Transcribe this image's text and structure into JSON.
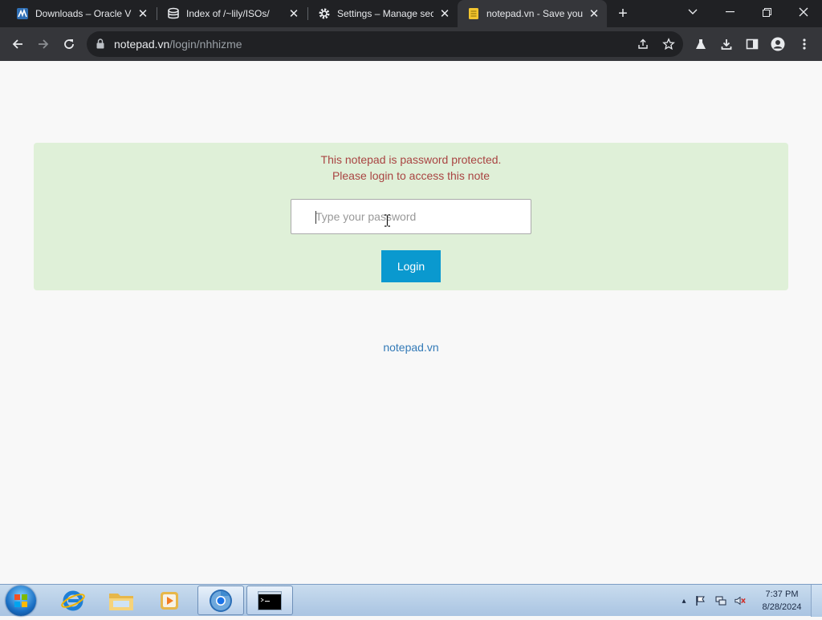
{
  "browser": {
    "tabs": [
      {
        "title": "Downloads – Oracle V",
        "favicon": "virtualbox-icon",
        "active": false
      },
      {
        "title": "Index of /~lily/ISOs/",
        "favicon": "server-icon",
        "active": false
      },
      {
        "title": "Settings – Manage sec",
        "favicon": "gear-icon",
        "active": false
      },
      {
        "title": "notepad.vn - Save you",
        "favicon": "notepad-icon",
        "active": true
      }
    ],
    "address": {
      "domain": "notepad.vn",
      "path": "/login/nhhizme"
    }
  },
  "page": {
    "message_line1": "This notepad is password protected.",
    "message_line2": "Please login to access this note",
    "password_placeholder": "Type your password",
    "login_label": "Login",
    "footer_link": "notepad.vn",
    "colors": {
      "panel_bg": "#dff0d8",
      "message": "#a94442",
      "button": "#0a99cf",
      "link": "#337ab7"
    }
  },
  "taskbar": {
    "apps": [
      "internet-explorer",
      "file-explorer",
      "media-player",
      "chrome",
      "command-prompt"
    ],
    "clock": {
      "time": "7:37 PM",
      "date": "8/28/2024"
    }
  }
}
